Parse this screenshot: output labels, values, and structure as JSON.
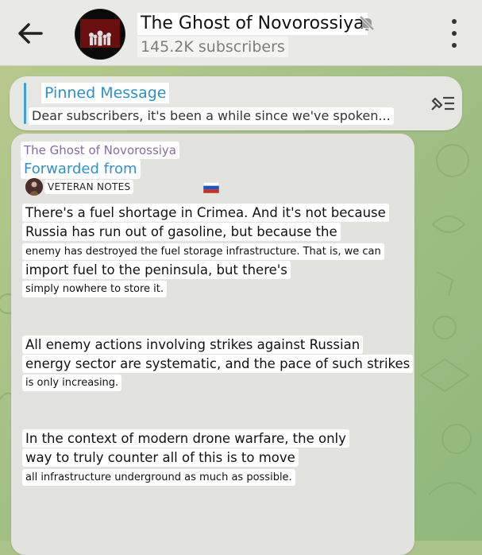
{
  "header": {
    "back_icon": "arrow-left-icon",
    "channel_title": "The Ghost of Novorossiya",
    "subscribers": "145.2K subscribers",
    "mute_icon": "muted-bell-icon",
    "menu_icon": "more-vertical-icon"
  },
  "pinned": {
    "title": "Pinned Message",
    "preview": "Dear subscribers, it's been a while since we've spoken...",
    "unpin_icon": "unpin-list-icon"
  },
  "message": {
    "sender": "The Ghost of Novorossiya",
    "forwarded_label": "Forwarded from",
    "forwarded_source": "VETERAN NOTES",
    "flag_icon": "russia-flag-icon",
    "paragraphs": [
      [
        "There's a fuel shortage in Crimea. And it's not because",
        "Russia has run out of gasoline, but because the",
        "enemy has destroyed the fuel storage infrastructure. That is, we can",
        "import fuel to the peninsula, but there's",
        "simply nowhere to store it."
      ],
      [
        "All enemy actions involving strikes against Russian",
        "energy sector are systematic, and the pace of such strikes",
        "is only increasing."
      ],
      [
        "In the context of modern drone warfare, the only",
        "way to truly counter all of this is to move",
        "all infrastructure underground as much as possible."
      ]
    ]
  },
  "colors": {
    "header_bg": "#e9e9e7",
    "accent_blue": "#2b92cf",
    "sender_purple": "#8a6aa2",
    "wallpaper_green": "#a3c085"
  }
}
